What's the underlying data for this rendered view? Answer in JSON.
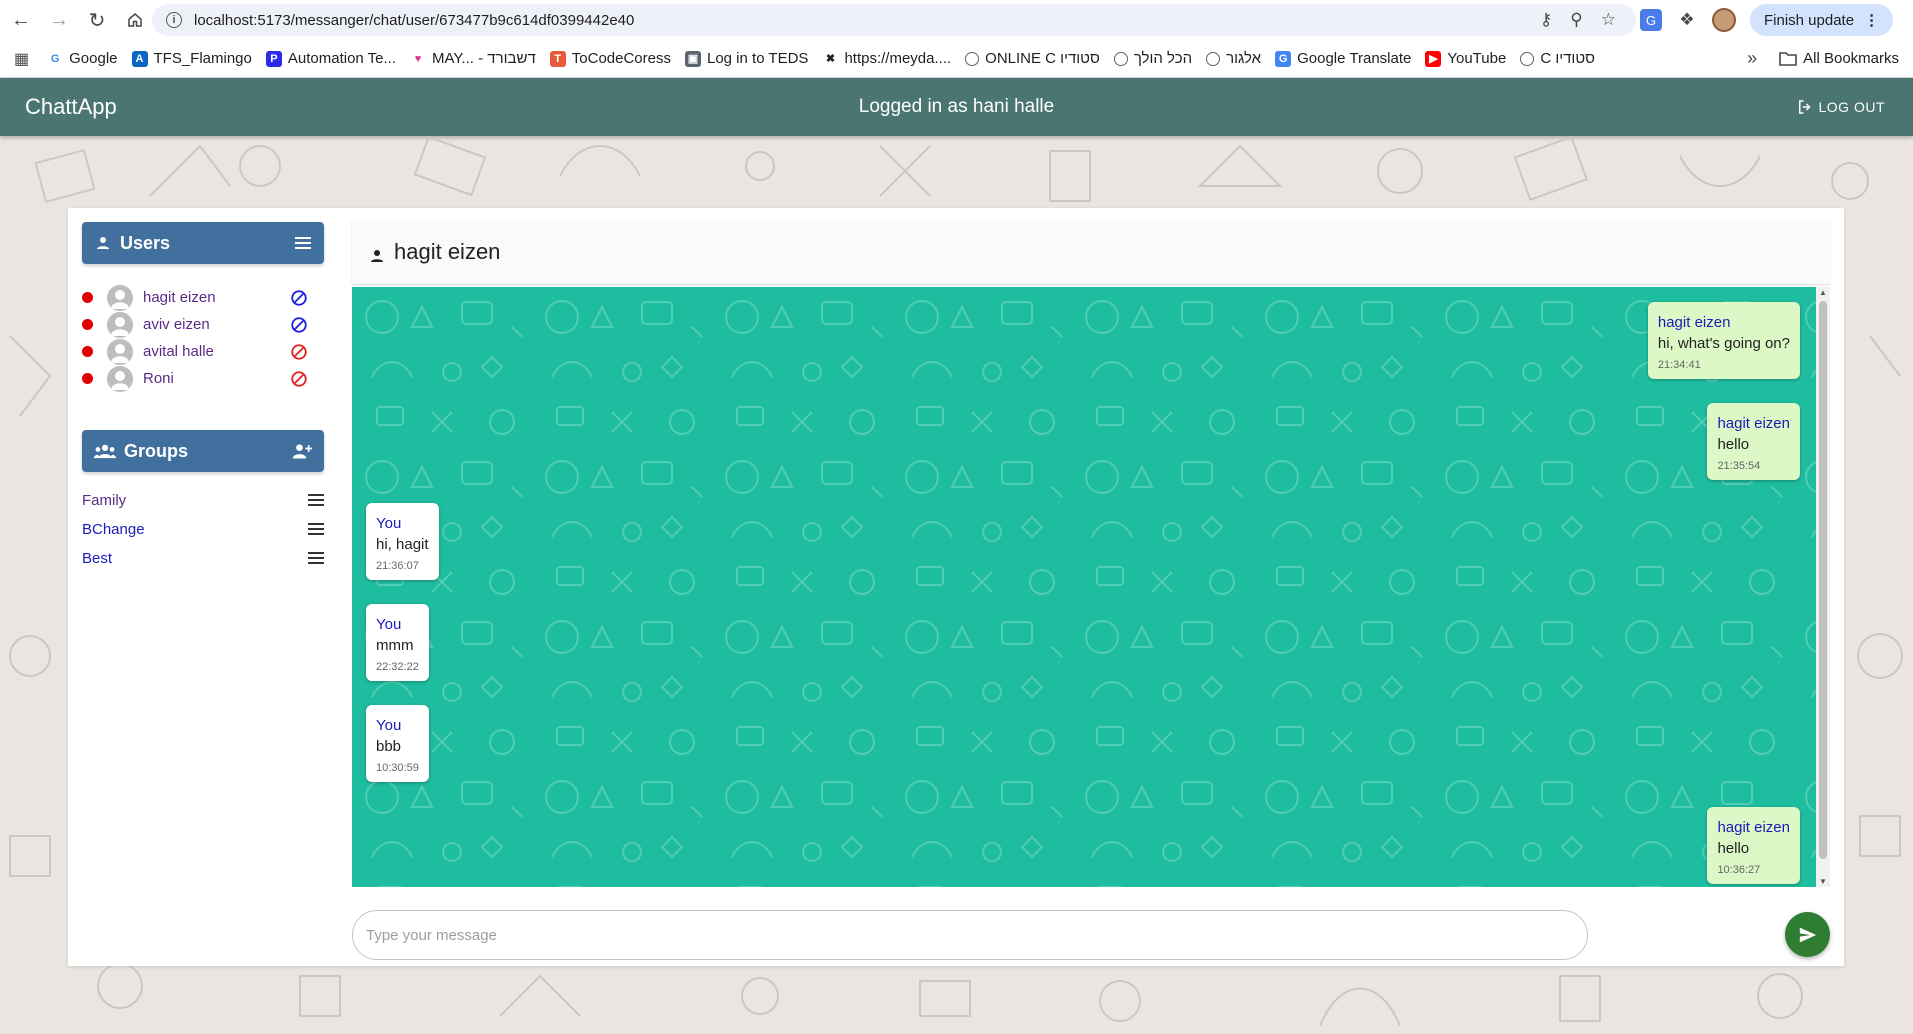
{
  "browser": {
    "url": "localhost:5173/messanger/chat/user/673477b9c614df0399442e40",
    "finish_update": "Finish update",
    "bookmarks": [
      {
        "label": "Google",
        "icon": "google-icon",
        "color": "#4285f4"
      },
      {
        "label": "TFS_Flamingo",
        "icon": "azure-icon",
        "color": "#0a68c2"
      },
      {
        "label": "Automation Te...",
        "icon": "p-icon",
        "color": "#2b2be8"
      },
      {
        "label": "MAY... - דשבורד",
        "icon": "heart-icon",
        "color": "#d63384"
      },
      {
        "label": "ToCodeCoress",
        "icon": "tocode-icon",
        "color": "#e8593a"
      },
      {
        "label": "Log in to TEDS",
        "icon": "teds-icon",
        "color": "#5b6470"
      },
      {
        "label": "https://meyda....",
        "icon": "x-icon",
        "color": "#222222"
      },
      {
        "label": "ONLINE C סטודיו",
        "icon": "globe-icon",
        "color": "#5f6368"
      },
      {
        "label": "הכל הולך",
        "icon": "globe-icon",
        "color": "#5f6368"
      },
      {
        "label": "אלגור",
        "icon": "globe-icon",
        "color": "#5f6368"
      },
      {
        "label": "Google Translate",
        "icon": "translate-icon",
        "color": "#4285f4"
      },
      {
        "label": "YouTube",
        "icon": "youtube-icon",
        "color": "#ff0000"
      },
      {
        "label": "C סטודיו",
        "icon": "globe-icon",
        "color": "#5f6368"
      }
    ],
    "all_bookmarks": "All Bookmarks"
  },
  "app": {
    "brand": "ChattApp",
    "logged_in": "Logged in as hani halle",
    "logout": "LOG OUT",
    "accent": "#4a7571"
  },
  "sidebar": {
    "users_title": "Users",
    "users": [
      {
        "name": "hagit eizen",
        "status": "offline",
        "block": "blue"
      },
      {
        "name": "aviv eizen",
        "status": "offline",
        "block": "blue"
      },
      {
        "name": "avital halle",
        "status": "offline",
        "block": "red"
      },
      {
        "name": "Roni",
        "status": "offline",
        "block": "red"
      }
    ],
    "groups_title": "Groups",
    "groups": [
      {
        "name": "Family"
      },
      {
        "name": "BChange"
      },
      {
        "name": "Best"
      }
    ]
  },
  "chat": {
    "contact": "hagit eizen",
    "messages": [
      {
        "from": "hagit eizen",
        "text": "hi, what's going on?",
        "time": "21:34:41",
        "side": "incoming"
      },
      {
        "from": "hagit eizen",
        "text": "hello",
        "time": "21:35:54",
        "side": "incoming"
      },
      {
        "from": "You",
        "text": "hi, hagit",
        "time": "21:36:07",
        "side": "outgoing"
      },
      {
        "from": "You",
        "text": "mmm",
        "time": "22:32:22",
        "side": "outgoing"
      },
      {
        "from": "You",
        "text": "bbb",
        "time": "10:30:59",
        "side": "outgoing"
      },
      {
        "from": "hagit eizen",
        "text": "hello",
        "time": "10:36:27",
        "side": "incoming"
      }
    ],
    "input_placeholder": "Type your message"
  }
}
